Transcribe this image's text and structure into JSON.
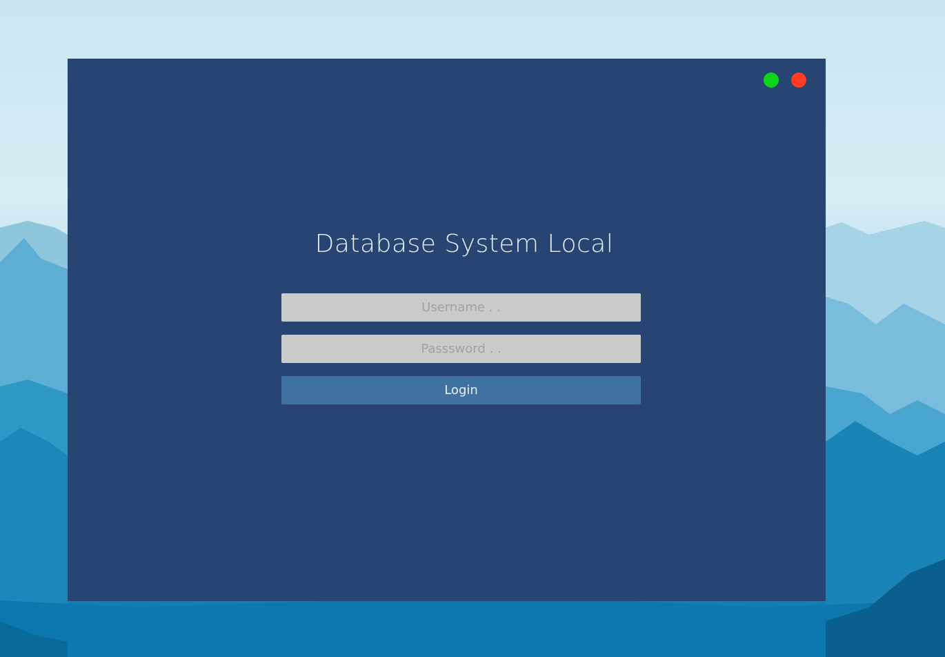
{
  "window": {
    "title": "Database System Local",
    "controls": {
      "maximize": {
        "icon": "green-circle-icon",
        "color": "#0fd41a"
      },
      "close": {
        "icon": "red-circle-icon",
        "color": "#ff3b24"
      }
    },
    "background_color": "#284472"
  },
  "form": {
    "username": {
      "value": "",
      "placeholder": "Username . ."
    },
    "password": {
      "value": "",
      "placeholder": "Passsword . ."
    },
    "login_label": "Login",
    "login_color": "#3f72a0"
  },
  "desktop": {
    "wallpaper": "blue-mountains-landscape"
  }
}
